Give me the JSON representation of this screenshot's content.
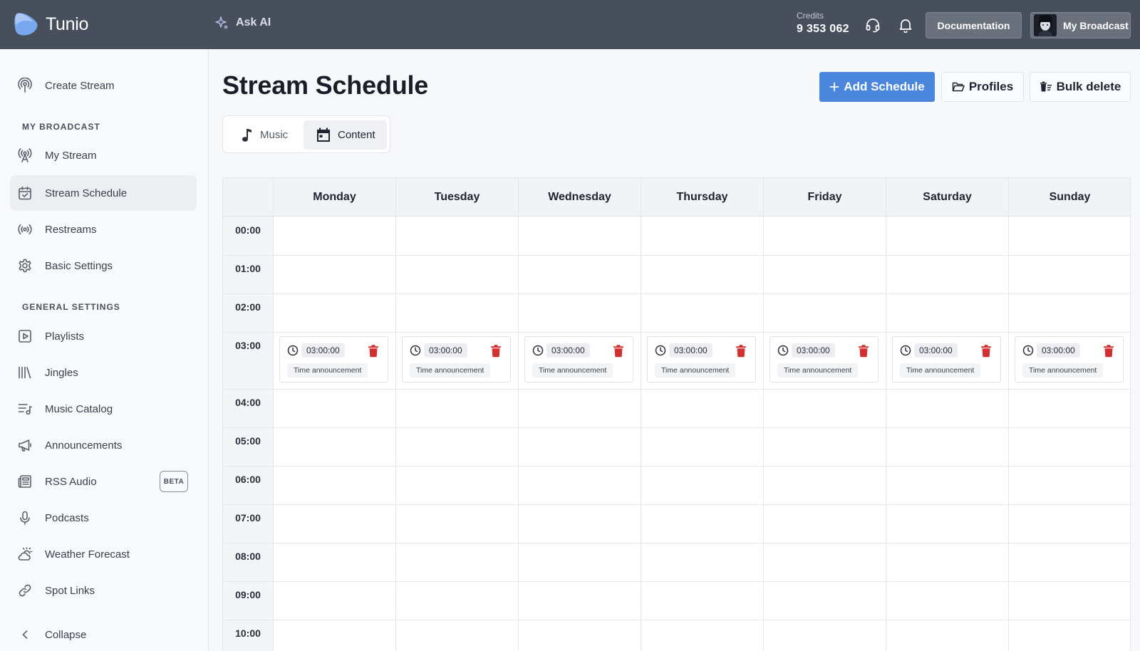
{
  "app": {
    "name": "Tunio"
  },
  "header": {
    "ask_ai": "Ask AI",
    "credits_label": "Credits",
    "credits_value": "9 353 062",
    "documentation": "Documentation",
    "account": "My Broadcast"
  },
  "sidebar": {
    "create_stream": "Create Stream",
    "section_broadcast": "MY BROADCAST",
    "broadcast_items": [
      {
        "label": "My Stream",
        "icon": "antenna-icon"
      },
      {
        "label": "Stream Schedule",
        "icon": "calendar-check-icon",
        "active": true
      },
      {
        "label": "Restreams",
        "icon": "broadcast-icon"
      },
      {
        "label": "Basic Settings",
        "icon": "gear-icon"
      }
    ],
    "section_general": "GENERAL SETTINGS",
    "general_items": [
      {
        "label": "Playlists",
        "icon": "play-square-icon"
      },
      {
        "label": "Jingles",
        "icon": "library-icon"
      },
      {
        "label": "Music Catalog",
        "icon": "music-list-icon"
      },
      {
        "label": "Announcements",
        "icon": "megaphone-icon"
      },
      {
        "label": "RSS Audio",
        "icon": "newspaper-icon",
        "badge": "BETA"
      },
      {
        "label": "Podcasts",
        "icon": "microphone-icon"
      },
      {
        "label": "Weather Forecast",
        "icon": "sun-cloud-icon"
      },
      {
        "label": "Spot Links",
        "icon": "link-icon"
      }
    ],
    "collapse": "Collapse"
  },
  "page": {
    "title": "Stream Schedule",
    "add_schedule": "Add Schedule",
    "profiles": "Profiles",
    "bulk_delete": "Bulk delete",
    "tabs": [
      {
        "label": "Music",
        "icon": "music-note-icon",
        "active": false
      },
      {
        "label": "Content",
        "icon": "calendar-icon",
        "active": true
      }
    ]
  },
  "schedule": {
    "days": [
      "Monday",
      "Tuesday",
      "Wednesday",
      "Thursday",
      "Friday",
      "Saturday",
      "Sunday"
    ],
    "hours": [
      "00:00",
      "01:00",
      "02:00",
      "03:00",
      "04:00",
      "05:00",
      "06:00",
      "07:00",
      "08:00",
      "09:00",
      "10:00"
    ],
    "entries": [
      {
        "day": 0,
        "hour": 3,
        "time": "03:00:00",
        "tag": "Time announcement"
      },
      {
        "day": 1,
        "hour": 3,
        "time": "03:00:00",
        "tag": "Time announcement"
      },
      {
        "day": 2,
        "hour": 3,
        "time": "03:00:00",
        "tag": "Time announcement"
      },
      {
        "day": 3,
        "hour": 3,
        "time": "03:00:00",
        "tag": "Time announcement"
      },
      {
        "day": 4,
        "hour": 3,
        "time": "03:00:00",
        "tag": "Time announcement"
      },
      {
        "day": 5,
        "hour": 3,
        "time": "03:00:00",
        "tag": "Time announcement"
      },
      {
        "day": 6,
        "hour": 3,
        "time": "03:00:00",
        "tag": "Time announcement"
      }
    ]
  },
  "colors": {
    "topbar": "#474f5c",
    "primary": "#4a86db",
    "danger": "#d32f2f"
  }
}
